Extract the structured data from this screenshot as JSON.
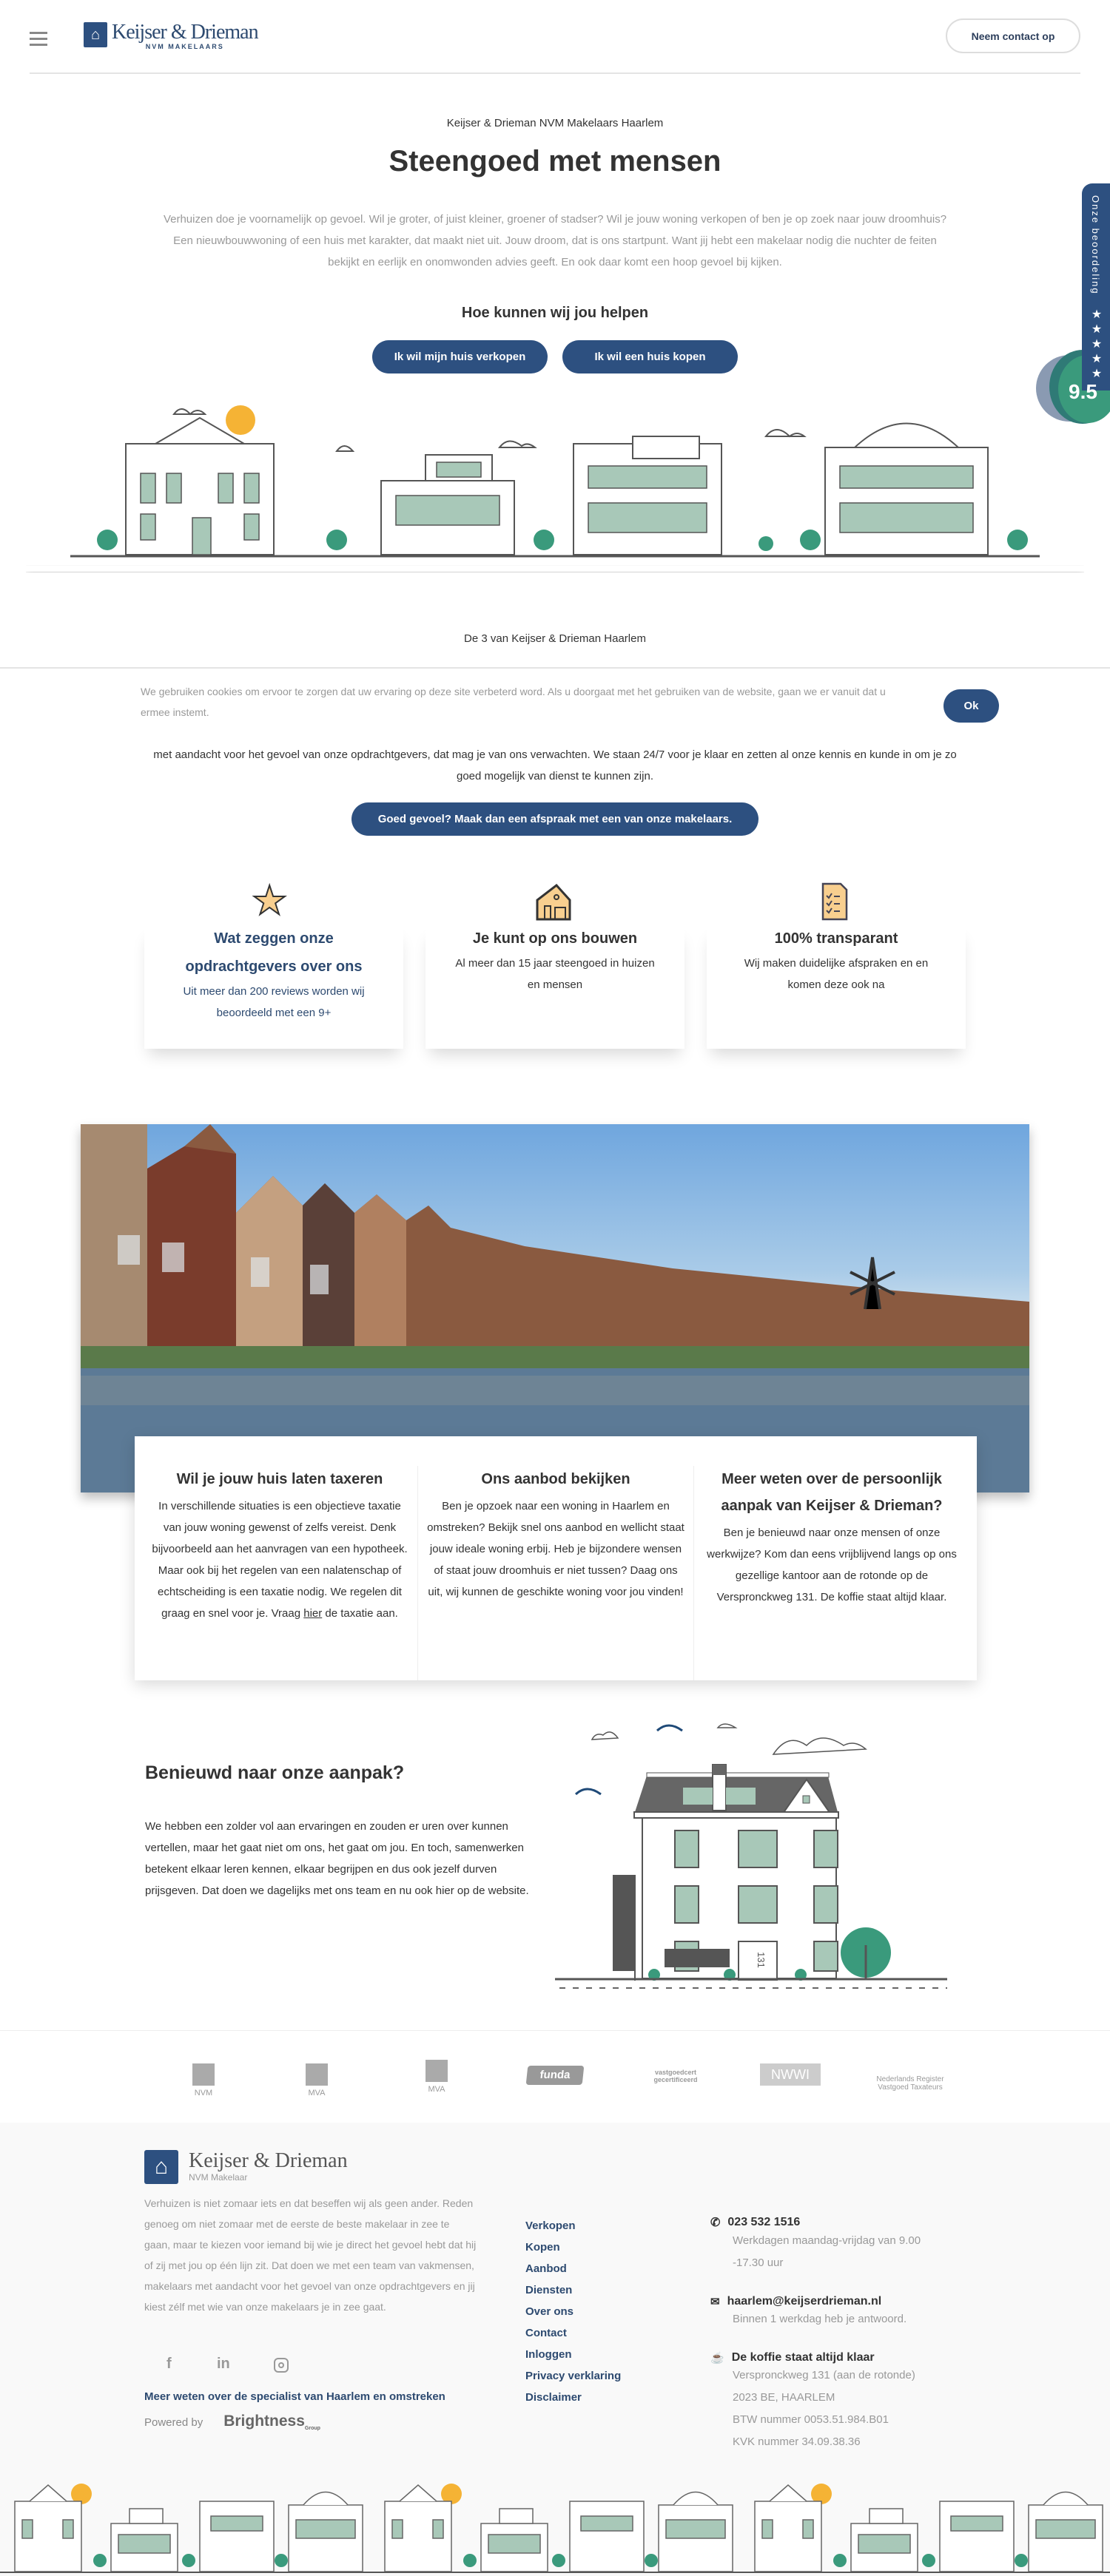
{
  "header": {
    "brand": "Keijser & Drieman",
    "brand_sub": "NVM MAKELAARS",
    "contact_button": "Neem contact op"
  },
  "hero": {
    "eyebrow": "Keijser & Drieman NVM Makelaars Haarlem",
    "title": "Steengoed met mensen",
    "paragraph": "Verhuizen doe je voornamelijk op gevoel. Wil je groter, of juist kleiner, groener of stadser? Wil je jouw woning verkopen of ben je op zoek naar jouw droomhuis? Een nieuwbouwwoning of een huis met karakter, dat maakt niet uit. Jouw droom, dat is ons startpunt. Want jij hebt een makelaar nodig die nuchter de feiten bekijkt en eerlijk en onomwonden advies geeft. En ook daar komt een hoop gevoel bij kijken.",
    "help_title": "Hoe kunnen wij jou helpen",
    "buttons": [
      "Ik wil mijn huis verkopen",
      "Ik wil een huis kopen"
    ]
  },
  "rating": {
    "label": "Onze beoordeling",
    "stars": 5,
    "score": "9.5"
  },
  "team": {
    "eyebrow": "De 3 van Keijser & Drieman Haarlem",
    "text": "met aandacht voor het gevoel van onze opdrachtgevers, dat mag je van ons verwachten. We staan 24/7 voor je klaar en zetten al onze kennis en kunde in om je zo goed mogelijk van dienst te kunnen zijn.",
    "cta": "Goed gevoel? Maak dan een afspraak met een van onze makelaars."
  },
  "cookie": {
    "text": "We gebruiken cookies om ervoor te zorgen dat uw ervaring op deze site verbeterd word. Als u doorgaat met het gebruiken van de website, gaan we er vanuit dat u ermee instemt.",
    "ok": "Ok"
  },
  "features": [
    {
      "icon": "star-icon",
      "title": "Wat zeggen onze opdrachtgevers over ons",
      "text": "Uit meer dan 200 reviews worden wij beoordeeld met een 9+"
    },
    {
      "icon": "house-icon",
      "title": "Je kunt op ons bouwen",
      "text": "Al meer dan 15 jaar steengoed in huizen en mensen"
    },
    {
      "icon": "checklist-icon",
      "title": "100% transparant",
      "text": "Wij maken duidelijke afspraken en en komen deze ook na"
    }
  ],
  "services": [
    {
      "title": "Wil je jouw huis laten taxeren",
      "text": "In verschillende situaties is een objectieve taxatie van jouw woning gewenst of zelfs vereist. Denk bijvoorbeeld aan het aanvragen van een hypotheek. Maar ook bij het regelen van een nalatenschap of echtscheiding is een taxatie nodig. We regelen dit graag en snel voor je.",
      "text_pre": "Vraag ",
      "link": "hier",
      "text_post": " de taxatie aan."
    },
    {
      "title": "Ons aanbod bekijken",
      "text": "Ben je opzoek naar een woning in Haarlem en omstreken? Bekijk snel ons aanbod en wellicht staat jouw ideale woning erbij. Heb je bijzondere wensen of staat jouw droomhuis er niet tussen? Daag ons uit, wij kunnen de geschikte woning voor jou vinden!"
    },
    {
      "title": "Meer weten over de persoonlijk aanpak van Keijser & Drieman?",
      "text": "Ben je benieuwd naar onze mensen of onze werkwijze? Kom dan eens vrijblijvend langs op ons gezellige kantoor aan de rotonde op de Verspronckweg 131. De koffie staat altijd klaar."
    }
  ],
  "approach": {
    "title": "Benieuwd naar onze aanpak?",
    "text": "We hebben een zolder vol aan ervaringen en zouden er uren over kunnen vertellen, maar het gaat niet om ons, het gaat om jou. En toch, samenwerken betekent elkaar leren kennen, elkaar begrijpen en dus ook jezelf durven prijsgeven. Dat doen we dagelijks met ons team en nu ook hier op de website.",
    "house_number": "131"
  },
  "partners": [
    "NVM",
    "MVA",
    "MVA",
    "funda",
    "vastgoedcert gecertificeerd",
    "NWWI",
    "Nederlands Register Vastgoed Taxateurs"
  ],
  "footer": {
    "brand": "Keijser & Drieman",
    "brand_sub": "NVM Makelaar",
    "about": "Verhuizen is niet zomaar iets en dat beseffen wij als geen ander. Reden genoeg om niet zomaar met de eerste de beste makelaar in zee te gaan, maar te kiezen voor iemand bij wie je direct het gevoel hebt dat hij of zij met jou op één lijn zit. Dat doen we met een team van vakmensen, makelaars met aandacht voor het gevoel van onze opdrachtgevers en jij kiest zélf met wie van onze makelaars je in zee gaat.",
    "specialist": "Meer weten over de specialist van Haarlem en omstreken",
    "powered_by": "Powered by",
    "powered_brand": "Brightness",
    "powered_brand_sub": "Group",
    "links": [
      "Verkopen",
      "Kopen",
      "Aanbod",
      "Diensten",
      "Over ons",
      "Contact",
      "Inloggen",
      "Privacy verklaring",
      "Disclaimer"
    ],
    "phone": "023 532 1516",
    "hours": "Werkdagen maandag-vrijdag van 9.00 -17.30 uur",
    "email": "haarlem@keijserdrieman.nl",
    "email_note": "Binnen 1 werkdag heb je antwoord.",
    "coffee": "De koffie staat altijd klaar",
    "address": [
      "Verspronckweg 131 (aan de rotonde)",
      "2023 BE, HAARLEM",
      "BTW nummer 0053.51.984.B01",
      "KVK nummer 34.09.38.36"
    ]
  },
  "colors": {
    "primary": "#2d5080",
    "green": "#3a9a7c",
    "window": "#a8c8b8"
  }
}
